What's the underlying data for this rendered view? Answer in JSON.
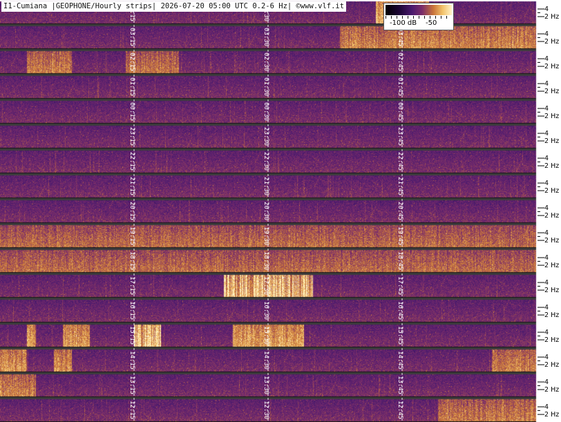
{
  "header": {
    "title": "I1-Cumiana |GEOPHONE/Hourly strips| 2026-07-20 05:00 UTC 0.2-6 Hz| ©www.vlf.it"
  },
  "colorbar": {
    "label_low": "-100 dB",
    "label_high": "-50"
  },
  "chart_data": {
    "type": "heatmap",
    "title": "I1-Cumiana |GEOPHONE/Hourly strips| 2026-07-20 05:00 UTC 0.2-6 Hz| ©www.vlf.it",
    "y_unit": "Hz",
    "freq_range": [
      0.2,
      6
    ],
    "color_range_db": [
      -100,
      -50
    ],
    "colormap": [
      "#000000",
      "#1a0533",
      "#4a1a6e",
      "#7b2d6a",
      "#c8743a",
      "#f2c26a",
      "#fff3c8"
    ],
    "strips": [
      {
        "quarter_labels": [
          "04:15",
          "04:30",
          "04:45"
        ]
      },
      {
        "quarter_labels": [
          "03:15",
          "03:30",
          "03:45"
        ]
      },
      {
        "quarter_labels": [
          "02:15",
          "02:30",
          "02:45"
        ]
      },
      {
        "quarter_labels": [
          "01:15",
          "01:30",
          "01:45"
        ]
      },
      {
        "quarter_labels": [
          "00:15",
          "00:30",
          "00:45"
        ]
      },
      {
        "quarter_labels": [
          "23:15",
          "23:30",
          "23:45"
        ]
      },
      {
        "quarter_labels": [
          "22:15",
          "22:30",
          "22:45"
        ]
      },
      {
        "quarter_labels": [
          "21:15",
          "21:30",
          "21:45"
        ]
      },
      {
        "quarter_labels": [
          "20:15",
          "20:30",
          "20:45"
        ]
      },
      {
        "quarter_labels": [
          "19:15",
          "19:30",
          "19:45"
        ]
      },
      {
        "quarter_labels": [
          "18:15",
          "18:30",
          "18:45"
        ]
      },
      {
        "quarter_labels": [
          "17:15",
          "17:30",
          "17:45"
        ]
      },
      {
        "quarter_labels": [
          "16:15",
          "16:30",
          "16:45"
        ]
      },
      {
        "quarter_labels": [
          "15:15",
          "15:30",
          "15:45"
        ]
      },
      {
        "quarter_labels": [
          "14:15",
          "14:30",
          "14:45"
        ]
      },
      {
        "quarter_labels": [
          "13:15",
          "13:30",
          "13:45"
        ]
      },
      {
        "quarter_labels": [
          "12:15",
          "12:30",
          "12:45"
        ]
      }
    ],
    "freq_tick_labels": [
      "4",
      "2 Hz"
    ],
    "bright_events": [
      {
        "strip": 0,
        "t_start_min": 42,
        "t_end_min": 48,
        "level": 0.85
      },
      {
        "strip": 1,
        "t_start_min": 38,
        "t_end_min": 60,
        "level": 0.6
      },
      {
        "strip": 2,
        "t_start_min": 3,
        "t_end_min": 8,
        "level": 0.55
      },
      {
        "strip": 2,
        "t_start_min": 14,
        "t_end_min": 20,
        "level": 0.5
      },
      {
        "strip": 9,
        "t_start_min": 0,
        "t_end_min": 60,
        "level": 0.45
      },
      {
        "strip": 10,
        "t_start_min": 0,
        "t_end_min": 60,
        "level": 0.45
      },
      {
        "strip": 11,
        "t_start_min": 25,
        "t_end_min": 35,
        "level": 1.0
      },
      {
        "strip": 13,
        "t_start_min": 3,
        "t_end_min": 4,
        "level": 0.75
      },
      {
        "strip": 13,
        "t_start_min": 7,
        "t_end_min": 10,
        "level": 0.75
      },
      {
        "strip": 13,
        "t_start_min": 15,
        "t_end_min": 18,
        "level": 0.95
      },
      {
        "strip": 13,
        "t_start_min": 26,
        "t_end_min": 34,
        "level": 0.8
      },
      {
        "strip": 14,
        "t_start_min": 0,
        "t_end_min": 3,
        "level": 0.7
      },
      {
        "strip": 14,
        "t_start_min": 6,
        "t_end_min": 8,
        "level": 0.6
      },
      {
        "strip": 14,
        "t_start_min": 55,
        "t_end_min": 60,
        "level": 0.6
      },
      {
        "strip": 15,
        "t_start_min": 0,
        "t_end_min": 4,
        "level": 0.6
      },
      {
        "strip": 16,
        "t_start_min": 49,
        "t_end_min": 60,
        "level": 0.55
      }
    ]
  }
}
